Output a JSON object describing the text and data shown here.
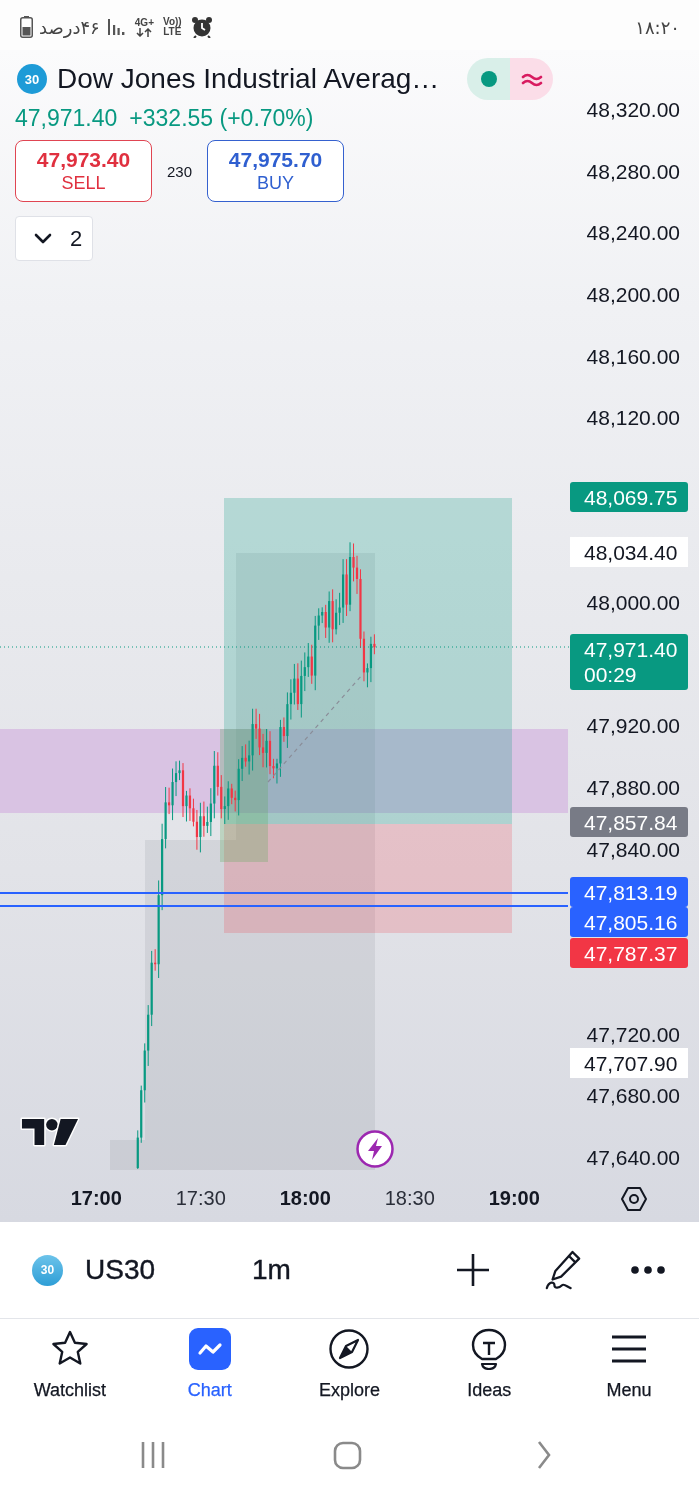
{
  "status_bar": {
    "battery": "۴۶درصد",
    "network": "4G+",
    "voice": [
      "Vo))",
      "LTE"
    ],
    "time": "۱۸:۲۰"
  },
  "header": {
    "badge": "30",
    "title": "Dow Jones Industrial Averag…",
    "price": "47,971.40",
    "change": "+332.55 (+0.70%)"
  },
  "trade": {
    "sell": {
      "price": "47,973.40",
      "label": "SELL"
    },
    "spread": "230",
    "buy": {
      "price": "47,975.70",
      "label": "BUY"
    }
  },
  "indicators_toggle": {
    "count": "2",
    "expanded": false
  },
  "chart": {
    "price_axis": [
      "48,320.00",
      "48,280.00",
      "48,240.00",
      "48,200.00",
      "48,160.00",
      "48,120.00",
      "48,000.00",
      "47,920.00",
      "47,880.00",
      "47,840.00",
      "47,720.00",
      "47,680.00",
      "47,640.00"
    ],
    "price_tags": [
      {
        "price": "48,069.75",
        "color": "#089981"
      },
      {
        "price": "48,034.40",
        "color": "#ffffff"
      },
      {
        "price": "47,971.40",
        "countdown": "00:29",
        "color": "#089981"
      },
      {
        "price": "47,857.84",
        "color": "#787b86"
      },
      {
        "price": "47,813.19",
        "color": "#2962ff"
      },
      {
        "price": "47,805.16",
        "color": "#2962ff"
      },
      {
        "price": "47,787.37",
        "color": "#f23645"
      },
      {
        "price": "47,707.90",
        "color": "#ffffff"
      }
    ],
    "time_axis": [
      {
        "label": "17:00",
        "major": true
      },
      {
        "label": "17:30",
        "major": false
      },
      {
        "label": "18:00",
        "major": true
      },
      {
        "label": "18:30",
        "major": false
      },
      {
        "label": "19:00",
        "major": true
      }
    ]
  },
  "toolbar": {
    "badge": "30",
    "symbol": "US30",
    "interval": "1m"
  },
  "bottom_nav": [
    {
      "label": "Watchlist",
      "selected": false
    },
    {
      "label": "Chart",
      "selected": true
    },
    {
      "label": "Explore",
      "selected": false
    },
    {
      "label": "Ideas",
      "selected": false
    },
    {
      "label": "Menu",
      "selected": false
    }
  ]
}
